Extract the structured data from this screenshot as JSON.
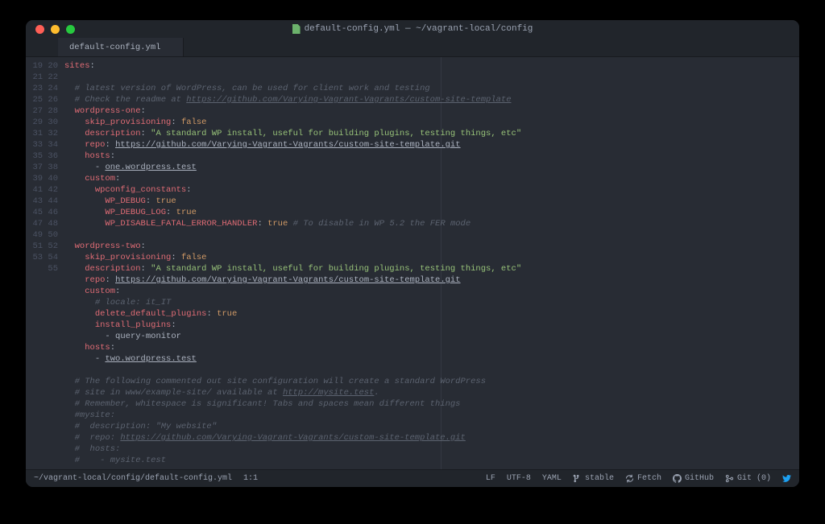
{
  "window": {
    "title": "default-config.yml — ~/vagrant-local/config"
  },
  "tab": {
    "label": "default-config.yml"
  },
  "gutter": {
    "start": 19,
    "end": 55
  },
  "code": {
    "l19": "sites",
    "l21": "# latest version of WordPress, can be used for client work and testing",
    "l22a": "# Check the readme at ",
    "l22b": "https://github.com/Varying-Vagrant-Vagrants/custom-site-template",
    "l23": "wordpress-one",
    "l24k": "skip_provisioning",
    "l24v": "false",
    "l25k": "description",
    "l25v": "\"A standard WP install, useful for building plugins, testing things, etc\"",
    "l26k": "repo",
    "l26v": "https://github.com/Varying-Vagrant-Vagrants/custom-site-template.git",
    "l27": "hosts",
    "l28": "one.wordpress.test",
    "l29": "custom",
    "l30": "wpconfig_constants",
    "l31k": "WP_DEBUG",
    "l31v": "true",
    "l32k": "WP_DEBUG_LOG",
    "l32v": "true",
    "l33k": "WP_DISABLE_FATAL_ERROR_HANDLER",
    "l33v": "true",
    "l33c": "# To disable in WP 5.2 the FER mode",
    "l35": "wordpress-two",
    "l36k": "skip_provisioning",
    "l36v": "false",
    "l37k": "description",
    "l37v": "\"A standard WP install, useful for building plugins, testing things, etc\"",
    "l38k": "repo",
    "l38v": "https://github.com/Varying-Vagrant-Vagrants/custom-site-template.git",
    "l39": "custom",
    "l40": "# locale: it_IT",
    "l41k": "delete_default_plugins",
    "l41v": "true",
    "l42": "install_plugins",
    "l43": "query-monitor",
    "l44": "hosts",
    "l45": "two.wordpress.test",
    "l47": "# The following commented out site configuration will create a standard WordPress",
    "l48a": "# site in www/example-site/ available at ",
    "l48b": "http://mysite.test",
    "l48c": ".",
    "l49": "# Remember, whitespace is significant! Tabs and spaces mean different things",
    "l50": "#mysite:",
    "l51": "#  description: \"My website\"",
    "l52a": "#  repo: ",
    "l52b": "https://github.com/Varying-Vagrant-Vagrants/custom-site-template.git",
    "l53": "#  hosts:",
    "l54": "#    - mysite.test"
  },
  "status": {
    "path": "~/vagrant-local/config/default-config.yml",
    "cursor": "1:1",
    "eol": "LF",
    "encoding": "UTF-8",
    "lang": "YAML",
    "branch": "stable",
    "fetch": "Fetch",
    "github": "GitHub",
    "git": "Git (0)"
  }
}
